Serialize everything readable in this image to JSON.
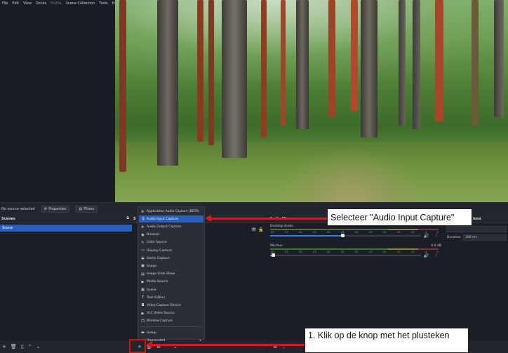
{
  "menubar": {
    "items": [
      "File",
      "Edit",
      "View",
      "Docks",
      "Profile",
      "Scene Collection",
      "Tools",
      "Help"
    ]
  },
  "toolbar": {
    "no_source": "No source selected",
    "properties": "Properties",
    "filters": "Filters"
  },
  "scenes": {
    "title": "Scenes",
    "items": [
      "Scene"
    ]
  },
  "sources": {
    "title": "S"
  },
  "mixer": {
    "title": "Audio Mixer",
    "channels": [
      {
        "name": "Desktop Audio",
        "db": "",
        "volume": 0.48
      },
      {
        "name": "Mic/Aux",
        "db": "0.0 dB",
        "volume": 0.02
      }
    ],
    "ticks": [
      "-60",
      "-55",
      "-50",
      "-45",
      "-40",
      "-35",
      "-30",
      "-25",
      "-20",
      "-15",
      "-10",
      "-5",
      "0"
    ]
  },
  "transitions": {
    "title": "ions",
    "duration_label": "Duration",
    "duration_value": "300 ms"
  },
  "add_menu": {
    "items": [
      {
        "label": "Application Audio Capture (BETA)",
        "icon": "speaker-icon"
      },
      {
        "label": "Audio Input Capture",
        "icon": "microphone-icon",
        "selected": true
      },
      {
        "label": "Audio Output Capture",
        "icon": "speaker-icon"
      },
      {
        "label": "Browser",
        "icon": "globe-icon"
      },
      {
        "label": "Color Source",
        "icon": "brush-icon"
      },
      {
        "label": "Display Capture",
        "icon": "monitor-icon"
      },
      {
        "label": "Game Capture",
        "icon": "gamepad-icon"
      },
      {
        "label": "Image",
        "icon": "image-icon"
      },
      {
        "label": "Image Slide Show",
        "icon": "slideshow-icon"
      },
      {
        "label": "Media Source",
        "icon": "play-icon"
      },
      {
        "label": "Scene",
        "icon": "scene-icon"
      },
      {
        "label": "Text (GDI+)",
        "icon": "text-icon"
      },
      {
        "label": "Video Capture Device",
        "icon": "camera-icon"
      },
      {
        "label": "VLC Video Source",
        "icon": "play-icon"
      },
      {
        "label": "Window Capture",
        "icon": "window-icon"
      },
      {
        "label": "Group",
        "icon": "folder-icon"
      },
      {
        "label": "Deprecated",
        "icon": ""
      }
    ]
  },
  "callouts": {
    "select": "Selecteer \"Audio Input Capture\"",
    "click_plus": "1. Klik op de knop met het plusteken"
  },
  "colors": {
    "selection": "#2a5fb8",
    "annotation": "#d81818"
  }
}
